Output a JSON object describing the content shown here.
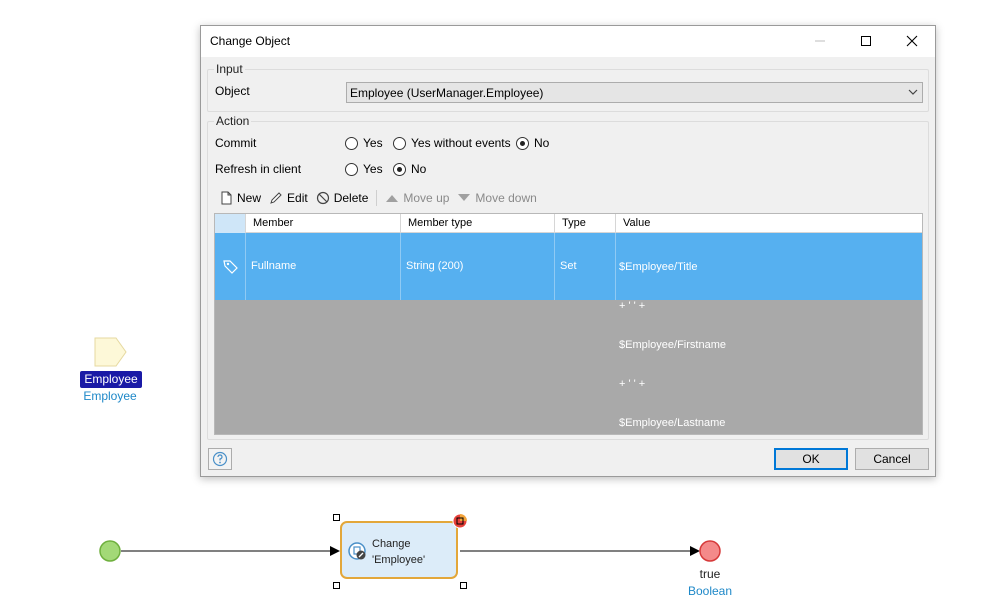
{
  "canvas": {
    "parameter": {
      "name": "Employee",
      "type": "Employee"
    },
    "activity": {
      "line1": "Change",
      "line2": "'Employee'"
    },
    "end_event": {
      "value": "true",
      "type": "Boolean"
    },
    "colors": {
      "start": "#a3d977",
      "end": "#f36b6b",
      "activity_border": "#e3a73a",
      "activity_fill": "#dcecf9"
    }
  },
  "dialog": {
    "title": "Change Object",
    "input_group": {
      "legend": "Input",
      "object_label": "Object",
      "object_value": "Employee (UserManager.Employee)"
    },
    "action_group": {
      "legend": "Action",
      "commit_label": "Commit",
      "commit_options": [
        "Yes",
        "Yes without events",
        "No"
      ],
      "commit_selected": "No",
      "refresh_label": "Refresh in client",
      "refresh_options": [
        "Yes",
        "No"
      ],
      "refresh_selected": "No"
    },
    "toolbar": {
      "new": "New",
      "edit": "Edit",
      "delete": "Delete",
      "move_up": "Move up",
      "move_down": "Move down"
    },
    "table": {
      "columns": [
        "Member",
        "Member type",
        "Type",
        "Value"
      ],
      "rows": [
        {
          "member": "Fullname",
          "member_type": "String (200)",
          "type": "Set",
          "value_lines": [
            "$Employee/Title",
            "+ ' ' +",
            "$Employee/Firstname",
            "+ ' ' +",
            "$Employee/Lastname"
          ]
        }
      ]
    },
    "buttons": {
      "ok": "OK",
      "cancel": "Cancel"
    },
    "icons": {
      "help": "help-icon",
      "minimize": "minimize-icon",
      "maximize": "maximize-icon",
      "close": "close-icon"
    },
    "colors": {
      "selected_row": "#56b0f0",
      "empty_grid": "#a9a9a9"
    }
  }
}
